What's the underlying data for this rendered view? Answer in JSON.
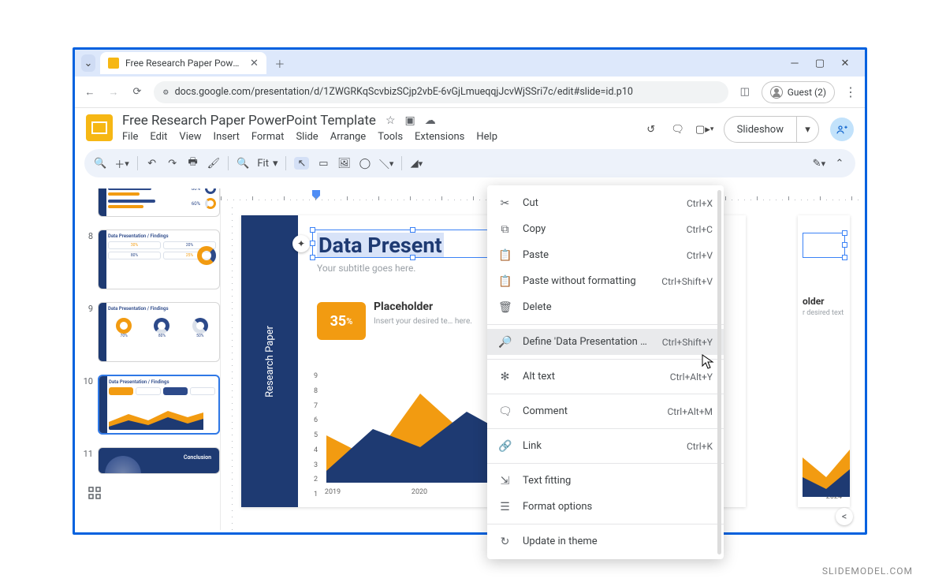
{
  "watermark": "SLIDEMODEL.COM",
  "browser": {
    "tab_title": "Free Research Paper PowerPoint",
    "url": "docs.google.com/presentation/d/1ZWGRKqScvbizSCjp2vbE-6vGjLmueqqjJcvWjSSri7c/edit#slide=id.p10",
    "guest_label": "Guest (2)"
  },
  "doc": {
    "title": "Free Research Paper PowerPoint Template",
    "menus": [
      "File",
      "Edit",
      "View",
      "Insert",
      "Format",
      "Slide",
      "Arrange",
      "Tools",
      "Extensions",
      "Help"
    ],
    "slideshow": "Slideshow"
  },
  "toolbar": {
    "fit": "Fit"
  },
  "thumbs": {
    "n7": "",
    "n8": "8",
    "n9": "9",
    "n10": "10",
    "n11": "11",
    "lbl": "Data Presentation / Findings",
    "concl": "Conclusion",
    "pct30": "30%",
    "pct20": "20%",
    "pct80a": "80%",
    "pct25": "25%",
    "pct70": "70%",
    "pct80b": "80%",
    "pct50": "50%",
    "pct60": "60%"
  },
  "slide": {
    "sidebar": "Research Paper",
    "title": "Data Present",
    "subtitle": "Your subtitle goes here.",
    "badge": "35",
    "badge_pct": "%",
    "ph1_title": "Placeholder",
    "ph1_desc": "Insert your desired te… here.",
    "peek_title": "older",
    "peek_desc": "r desired text",
    "peek_year": "2024"
  },
  "chart_data": {
    "type": "area",
    "x": [
      2019,
      2020
    ],
    "y_ticks": [
      1,
      2,
      3,
      4,
      5,
      6,
      7,
      8,
      9
    ],
    "ylim": [
      0,
      9
    ],
    "series": [
      {
        "name": "blue",
        "color": "#1e3a72",
        "values": [
          1.0,
          4.5,
          3.0,
          6.0,
          3.8
        ]
      },
      {
        "name": "orange",
        "color": "#f29b11",
        "values": [
          4.0,
          2.0,
          7.5,
          4.0,
          6.5
        ]
      }
    ]
  },
  "context_menu": {
    "items": [
      {
        "icon": "✂",
        "label": "Cut",
        "sc": "Ctrl+X"
      },
      {
        "icon": "⧉",
        "label": "Copy",
        "sc": "Ctrl+C"
      },
      {
        "icon": "📋",
        "label": "Paste",
        "sc": "Ctrl+V"
      },
      {
        "icon": "📋",
        "label": "Paste without formatting",
        "sc": "Ctrl+Shift+V"
      },
      {
        "icon": "🗑",
        "label": "Delete",
        "sc": ""
      },
      {
        "sep": true
      },
      {
        "icon": "🔎",
        "label": "Define 'Data Presentation /…'",
        "sc": "Ctrl+Shift+Y",
        "hov": true
      },
      {
        "sep": true
      },
      {
        "icon": "✻",
        "label": "Alt text",
        "sc": "Ctrl+Alt+Y"
      },
      {
        "sep": true
      },
      {
        "icon": "🗨",
        "label": "Comment",
        "sc": "Ctrl+Alt+M"
      },
      {
        "sep": true
      },
      {
        "icon": "🔗",
        "label": "Link",
        "sc": "Ctrl+K"
      },
      {
        "sep": true
      },
      {
        "icon": "⇲",
        "label": "Text fitting",
        "sc": ""
      },
      {
        "icon": "☰",
        "label": "Format options",
        "sc": ""
      },
      {
        "sep": true
      },
      {
        "icon": "↻",
        "label": "Update in theme",
        "sc": ""
      }
    ]
  }
}
